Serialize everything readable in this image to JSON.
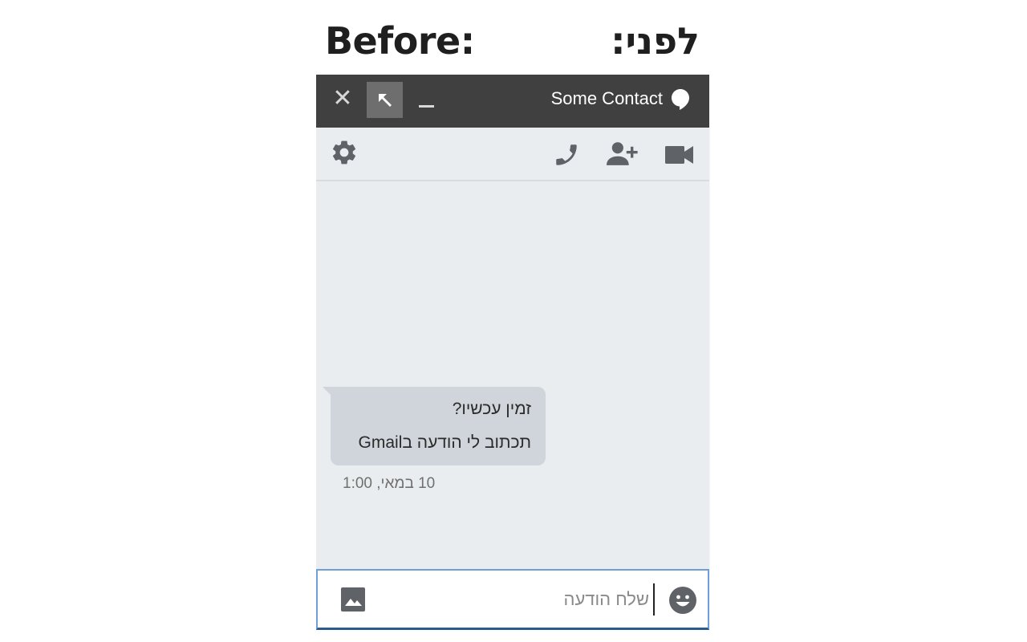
{
  "headings": {
    "english": "Before:",
    "hebrew": "לפני:"
  },
  "chat_window": {
    "contact_name": "Some Contact",
    "titlebar_icons": {
      "close": "close-icon",
      "popout": "popout-arrow-icon",
      "minimize": "minimize-icon",
      "app": "hangouts-icon"
    },
    "toolbar_icons": [
      "gear-icon",
      "phone-icon",
      "add-person-icon",
      "video-camera-icon"
    ],
    "messages": [
      {
        "lines": [
          "זמין עכשיו?",
          "תכתוב לי הודעה בGmail"
        ],
        "timestamp": "10 במאי, 1:00"
      }
    ],
    "composer": {
      "placeholder": "שלח הודעה",
      "image_icon": "image-icon",
      "emoji_icon": "emoji-icon"
    }
  },
  "colors": {
    "titlebar_bg": "#404040",
    "chat_bg": "#e9edf0",
    "bubble_bg": "#cfd5da",
    "icon_gray": "#5f6368",
    "composer_border": "#6f9fd8"
  }
}
